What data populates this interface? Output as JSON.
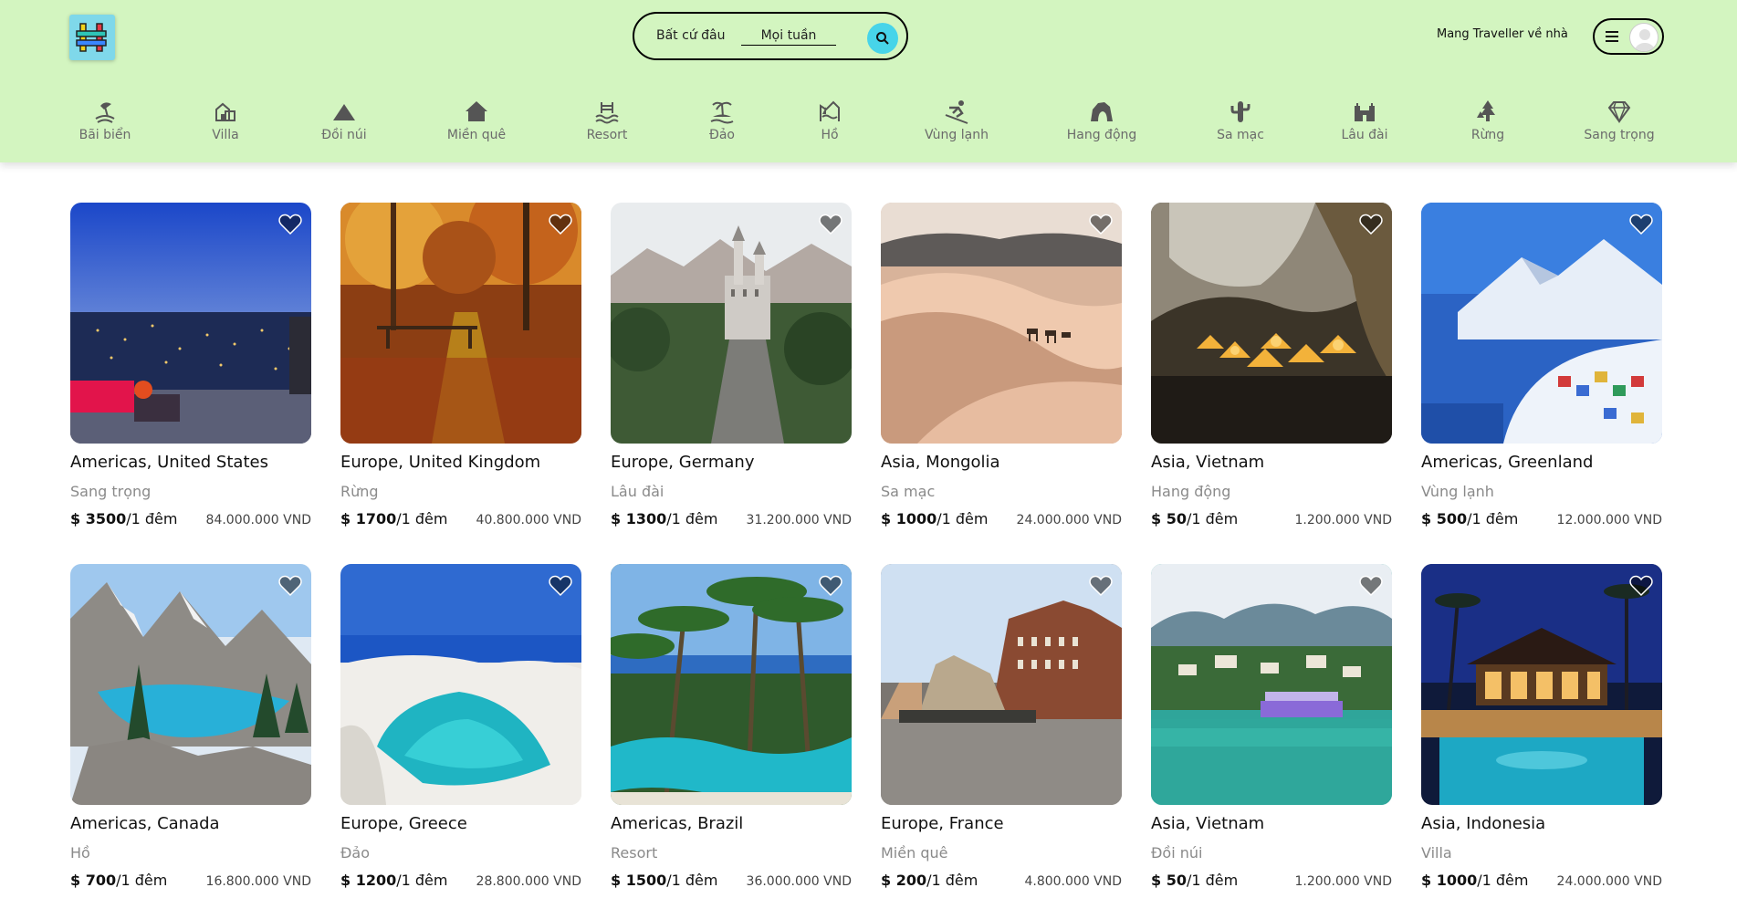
{
  "header": {
    "search_where": "Bất cứ đâu",
    "search_when": "Mọi tuần",
    "host_label": "Mang Traveller về nhà",
    "brand_color": "#d3f5c0",
    "accent_color": "#47d4e9"
  },
  "categories": [
    {
      "label": "Bãi biển",
      "icon": "beach-icon"
    },
    {
      "label": "Villa",
      "icon": "villa-icon"
    },
    {
      "label": "Đồi núi",
      "icon": "mountain-icon"
    },
    {
      "label": "Miền quê",
      "icon": "countryside-icon"
    },
    {
      "label": "Resort",
      "icon": "resort-icon"
    },
    {
      "label": "Đảo",
      "icon": "island-icon"
    },
    {
      "label": "Hồ",
      "icon": "lake-icon"
    },
    {
      "label": "Vùng lạnh",
      "icon": "ski-icon"
    },
    {
      "label": "Hang động",
      "icon": "cave-icon"
    },
    {
      "label": "Sa mạc",
      "icon": "cactus-icon"
    },
    {
      "label": "Lâu đài",
      "icon": "castle-icon"
    },
    {
      "label": "Rừng",
      "icon": "forest-icon"
    },
    {
      "label": "Sang trọng",
      "icon": "diamond-icon"
    }
  ],
  "listings": [
    {
      "location": "Americas, United States",
      "type": "Sang trọng",
      "price": "$ 3500",
      "per": "/1 đêm",
      "vnd": "84.000.000 VND"
    },
    {
      "location": "Europe, United Kingdom",
      "type": "Rừng",
      "price": "$ 1700",
      "per": "/1 đêm",
      "vnd": "40.800.000 VND"
    },
    {
      "location": "Europe, Germany",
      "type": "Lâu đài",
      "price": "$ 1300",
      "per": "/1 đêm",
      "vnd": "31.200.000 VND"
    },
    {
      "location": "Asia, Mongolia",
      "type": "Sa mạc",
      "price": "$ 1000",
      "per": "/1 đêm",
      "vnd": "24.000.000 VND"
    },
    {
      "location": "Asia, Vietnam",
      "type": "Hang động",
      "price": "$ 50",
      "per": "/1 đêm",
      "vnd": "1.200.000 VND"
    },
    {
      "location": "Americas, Greenland",
      "type": "Vùng lạnh",
      "price": "$ 500",
      "per": "/1 đêm",
      "vnd": "12.000.000 VND"
    },
    {
      "location": "Americas, Canada",
      "type": "Hồ",
      "price": "$ 700",
      "per": "/1 đêm",
      "vnd": "16.800.000 VND"
    },
    {
      "location": "Europe, Greece",
      "type": "Đảo",
      "price": "$ 1200",
      "per": "/1 đêm",
      "vnd": "28.800.000 VND"
    },
    {
      "location": "Americas, Brazil",
      "type": "Resort",
      "price": "$ 1500",
      "per": "/1 đêm",
      "vnd": "36.000.000 VND"
    },
    {
      "location": "Europe, France",
      "type": "Miền quê",
      "price": "$ 200",
      "per": "/1 đêm",
      "vnd": "4.800.000 VND"
    },
    {
      "location": "Asia, Vietnam",
      "type": "Đồi núi",
      "price": "$ 50",
      "per": "/1 đêm",
      "vnd": "1.200.000 VND"
    },
    {
      "location": "Asia, Indonesia",
      "type": "Villa",
      "price": "$ 1000",
      "per": "/1 đêm",
      "vnd": "24.000.000 VND"
    }
  ]
}
